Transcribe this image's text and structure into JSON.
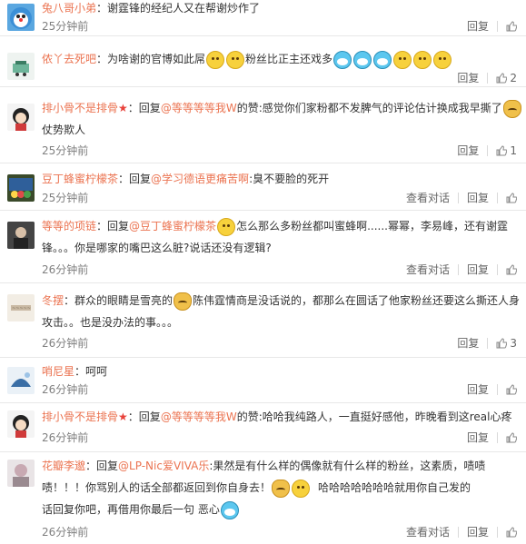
{
  "comments": [
    {
      "user": "兔八哥小弟",
      "text": "谢霆锋的经纪人又在帮谢炒作了",
      "time": "25分钟前",
      "reply": "回复",
      "likes": ""
    },
    {
      "user": "侬丫去死吧",
      "text": "为啥谢的官博如此屌",
      "text2": "粉丝比正主还戏多",
      "time": "25分钟前",
      "reply": "回复",
      "likes": "2"
    },
    {
      "user": "排小骨不是排骨",
      "prefix": "回复",
      "mention": "@等等等等我W",
      "text": "的赞:感觉你们家粉都不发脾气的评论估计换成我早撕了",
      "text2": "仗势欺人",
      "time": "25分钟前",
      "reply": "回复",
      "likes": "1"
    },
    {
      "user": "豆丁蜂蜜柠檬茶",
      "prefix": "回复",
      "mention": "@学习德语更痛苦啊",
      "text": ":臭不要脸的死开",
      "time": "25分钟前",
      "dialog": "查看对话",
      "reply": "回复",
      "likes": ""
    },
    {
      "user": "等等的项链",
      "prefix": "回复",
      "mention": "@豆丁蜂蜜柠檬茶",
      "text": "怎么那么多粉丝都叫蜜蜂啊......幂幂，李易峰，还有谢霆",
      "text2": "锋。。。你是哪家的嘴巴这么脏?说话还没有逻辑?",
      "time": "26分钟前",
      "dialog": "查看对话",
      "reply": "回复",
      "likes": ""
    },
    {
      "user": "冬摆",
      "text": "群众的眼睛是雪亮的",
      "text_b": "陈伟霆情商是没话说的，都那么在圆话了他家粉丝还要这么撕还人身",
      "text2": "攻击。。也是没办法的事。。。",
      "time": "26分钟前",
      "reply": "回复",
      "likes": "3"
    },
    {
      "user": "哨尼星",
      "text": "呵呵",
      "time": "26分钟前",
      "reply": "回复",
      "likes": ""
    },
    {
      "user": "排小骨不是排骨",
      "prefix": "回复",
      "mention": "@等等等等我W",
      "text": "的赞:哈哈我纯路人，一直挺好感他，昨晚看到这real心疼",
      "time": "26分钟前",
      "reply": "回复",
      "likes": ""
    },
    {
      "user": "花瓣李邈",
      "prefix": "回复",
      "mention": "@LP-Nic爱VIVA乐",
      "text": ":果然是有什么样的偶像就有什么样的粉丝，这素质，啧啧",
      "text2": "啧！！！你骂别人的话全部都返回到你自身去！",
      "text2b": "哈哈哈哈哈哈哈就用你自己发的",
      "text3": "话回复你吧，再借用你最后一句  恶心",
      "time": "26分钟前",
      "dialog": "查看对话",
      "reply": "回复",
      "likes": ""
    }
  ],
  "icons": {
    "thumb": "thumb-up-icon",
    "star": "star-icon"
  }
}
